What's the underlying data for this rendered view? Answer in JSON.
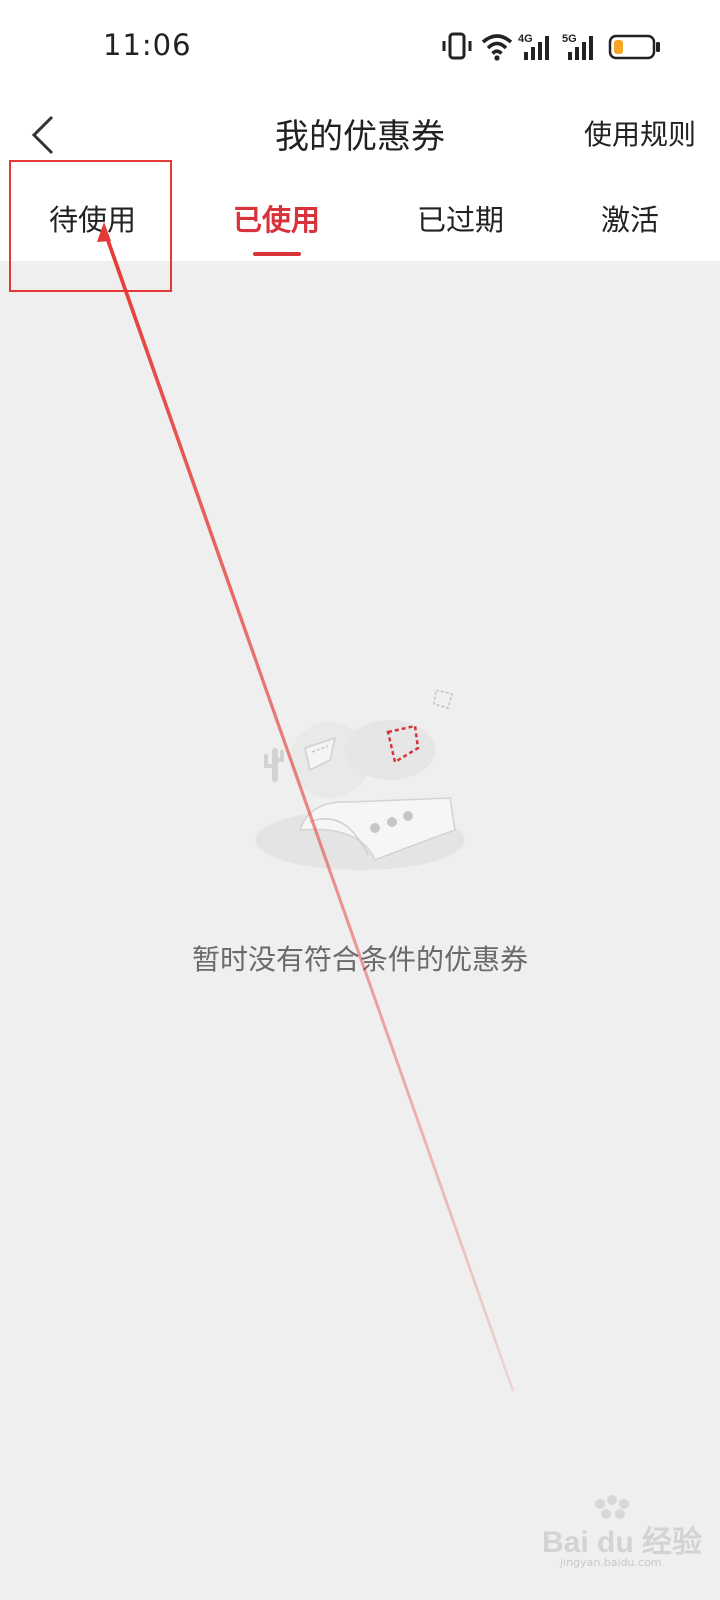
{
  "status_bar": {
    "time": "11:06",
    "icons": [
      "vibrate-icon",
      "wifi-icon",
      "signal-4g-icon",
      "signal-5g-icon",
      "battery-low-icon"
    ],
    "labels": {
      "net1": "4G",
      "net2": "5G"
    }
  },
  "nav": {
    "back_icon": "chevron-left-icon",
    "title": "我的优惠券",
    "rules_label": "使用规则"
  },
  "tabs": [
    {
      "label": "待使用",
      "active": false
    },
    {
      "label": "已使用",
      "active": true
    },
    {
      "label": "已过期",
      "active": false
    },
    {
      "label": "激活",
      "active": false
    }
  ],
  "empty_state": {
    "illustration": "empty-coupon-illustration",
    "message": "暂时没有符合条件的优惠券"
  },
  "colors": {
    "accent": "#d8323a",
    "page_bg": "#efefef",
    "annotation": "#e53935"
  },
  "watermark": {
    "brand": "Bai du 经验",
    "url": "jingyan.baidu.com"
  }
}
